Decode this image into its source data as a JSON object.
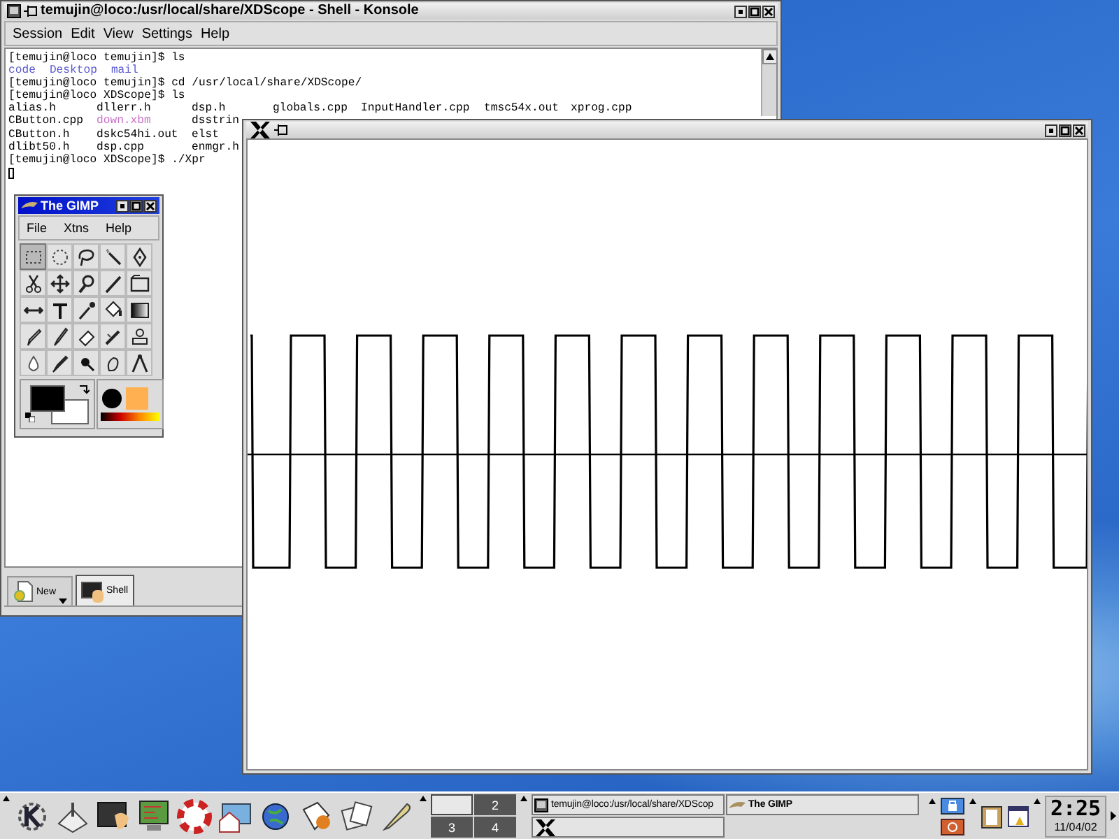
{
  "konsole": {
    "title": "temujin@loco:/usr/local/share/XDScope - Shell - Konsole",
    "menu": [
      "Session",
      "Edit",
      "View",
      "Settings",
      "Help"
    ],
    "lines": [
      {
        "kind": "command",
        "text": "[temujin@loco temujin]$ ls"
      },
      {
        "kind": "files",
        "files": [
          {
            "name": "code",
            "color": "#5a5ad2"
          },
          {
            "name": "Desktop",
            "color": "#5a5ad2"
          },
          {
            "name": "mail",
            "color": "#5a5ad2"
          }
        ]
      },
      {
        "kind": "command",
        "text": "[temujin@loco temujin]$ cd /usr/local/share/XDScope/"
      },
      {
        "kind": "command",
        "text": "[temujin@loco XDScope]$ ls"
      },
      {
        "kind": "columns",
        "files": [
          {
            "name": "alias.h",
            "color": "#000000"
          },
          {
            "name": "dllerr.h",
            "color": "#000000"
          },
          {
            "name": "dsp.h",
            "color": "#000000"
          },
          {
            "name": "globals.cpp",
            "color": "#000000"
          },
          {
            "name": "InputHandler.cpp",
            "color": "#000000"
          },
          {
            "name": "tmsc54x.out",
            "color": "#000000"
          },
          {
            "name": "xprog.cpp",
            "color": "#000000"
          }
        ]
      },
      {
        "kind": "columns",
        "files": [
          {
            "name": "CButton.cpp",
            "color": "#000000"
          },
          {
            "name": "down.xbm",
            "color": "#c870c8"
          },
          {
            "name": "dsstrin",
            "color": "#000000"
          }
        ]
      },
      {
        "kind": "columns",
        "files": [
          {
            "name": "CButton.h",
            "color": "#000000"
          },
          {
            "name": "dskc54hi.out",
            "color": "#000000"
          },
          {
            "name": "elst",
            "color": "#000000"
          }
        ]
      },
      {
        "kind": "columns",
        "files": [
          {
            "name": "dlibt50.h",
            "color": "#000000"
          },
          {
            "name": "dsp.cpp",
            "color": "#000000"
          },
          {
            "name": "enmgr.h",
            "color": "#000000"
          }
        ]
      },
      {
        "kind": "command",
        "text": "[temujin@loco XDScope]$ ./Xpr"
      },
      {
        "kind": "cursor"
      }
    ],
    "tabs": [
      {
        "label": "New",
        "kind": "new",
        "selected": false
      },
      {
        "label": "Shell",
        "kind": "shell",
        "selected": true
      }
    ]
  },
  "gimp": {
    "title": "The GIMP",
    "menu": [
      "File",
      "Xtns",
      "Help"
    ],
    "tools": [
      {
        "kind": "rect",
        "selected": true
      },
      {
        "kind": "ellipse",
        "selected": false
      },
      {
        "kind": "lasso",
        "selected": false
      },
      {
        "kind": "wand",
        "selected": false
      },
      {
        "kind": "bezier",
        "selected": false
      },
      {
        "kind": "scissors",
        "selected": false
      },
      {
        "kind": "move",
        "selected": false
      },
      {
        "kind": "magnify",
        "selected": false
      },
      {
        "kind": "crop",
        "selected": false
      },
      {
        "kind": "transform",
        "selected": false
      },
      {
        "kind": "flip",
        "selected": false
      },
      {
        "kind": "text",
        "selected": false
      },
      {
        "kind": "picker",
        "selected": false
      },
      {
        "kind": "bucket",
        "selected": false
      },
      {
        "kind": "gradient",
        "selected": false
      },
      {
        "kind": "pencil",
        "selected": false
      },
      {
        "kind": "brush",
        "selected": false
      },
      {
        "kind": "eraser",
        "selected": false
      },
      {
        "kind": "airbrush",
        "selected": false
      },
      {
        "kind": "clone",
        "selected": false
      },
      {
        "kind": "drop",
        "selected": false
      },
      {
        "kind": "ink",
        "selected": false
      },
      {
        "kind": "dodge",
        "selected": false
      },
      {
        "kind": "smudge",
        "selected": false
      },
      {
        "kind": "measure",
        "selected": false
      }
    ]
  },
  "taskbar": {
    "launchers": [
      {
        "kind": "kmenu"
      },
      {
        "kind": "desktop"
      },
      {
        "kind": "shell"
      },
      {
        "kind": "computer"
      },
      {
        "kind": "help"
      },
      {
        "kind": "home"
      },
      {
        "kind": "browser"
      },
      {
        "kind": "mail"
      },
      {
        "kind": "files"
      },
      {
        "kind": "editor"
      }
    ],
    "desks": [
      {
        "selected": true
      },
      {
        "label": "2",
        "selected": false
      },
      {
        "label": "3",
        "selected": false
      },
      {
        "label": "4",
        "selected": false
      }
    ],
    "tasks": [
      {
        "kind": "terminal",
        "label": "temujin@loco:/usr/local/share/XDScop"
      },
      {
        "kind": "gimp",
        "label": "The GIMP"
      },
      {
        "kind": "x"
      }
    ],
    "clock": {
      "time": "2:25",
      "date": "11/04/02"
    }
  }
}
